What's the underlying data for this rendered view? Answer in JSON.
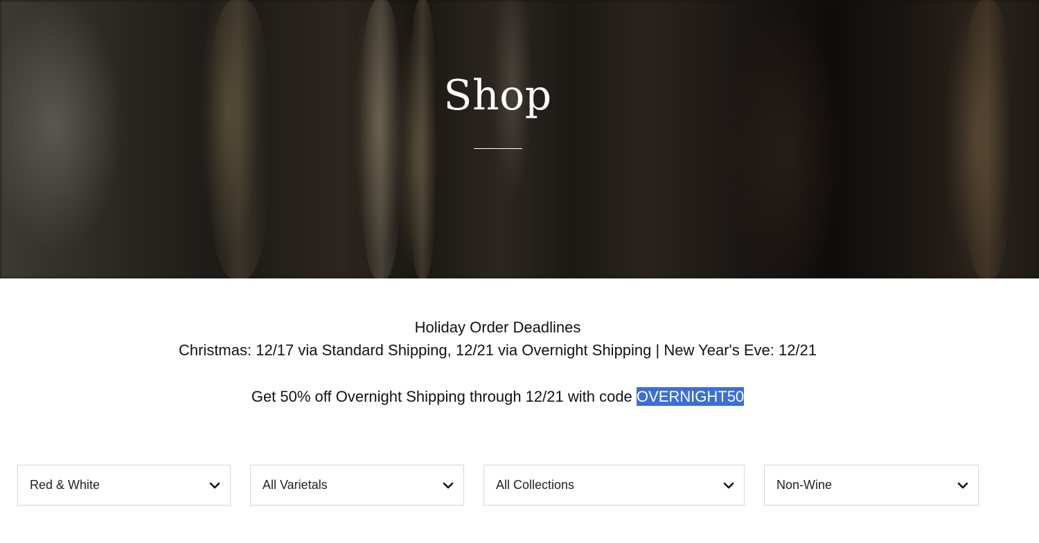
{
  "hero": {
    "title": "Shop"
  },
  "notice": {
    "heading": "Holiday Order Deadlines",
    "deadlines": "Christmas: 12/17 via Standard Shipping, 12/21 via Overnight Shipping | New Year's Eve: 12/21",
    "promo_text": "Get 50% off Overnight Shipping through 12/21 with code ",
    "promo_code": "OVERNIGHT50"
  },
  "filters": [
    {
      "label": "Red & White",
      "icon": "chevron-down-icon"
    },
    {
      "label": "All Varietals",
      "icon": "chevron-down-icon"
    },
    {
      "label": "All Collections",
      "icon": "chevron-down-icon"
    },
    {
      "label": "Non-Wine",
      "icon": "chevron-down-icon"
    }
  ],
  "colors": {
    "selection_highlight": "#3b6fd4",
    "filter_border": "#d4d4d4",
    "text": "#111111"
  }
}
